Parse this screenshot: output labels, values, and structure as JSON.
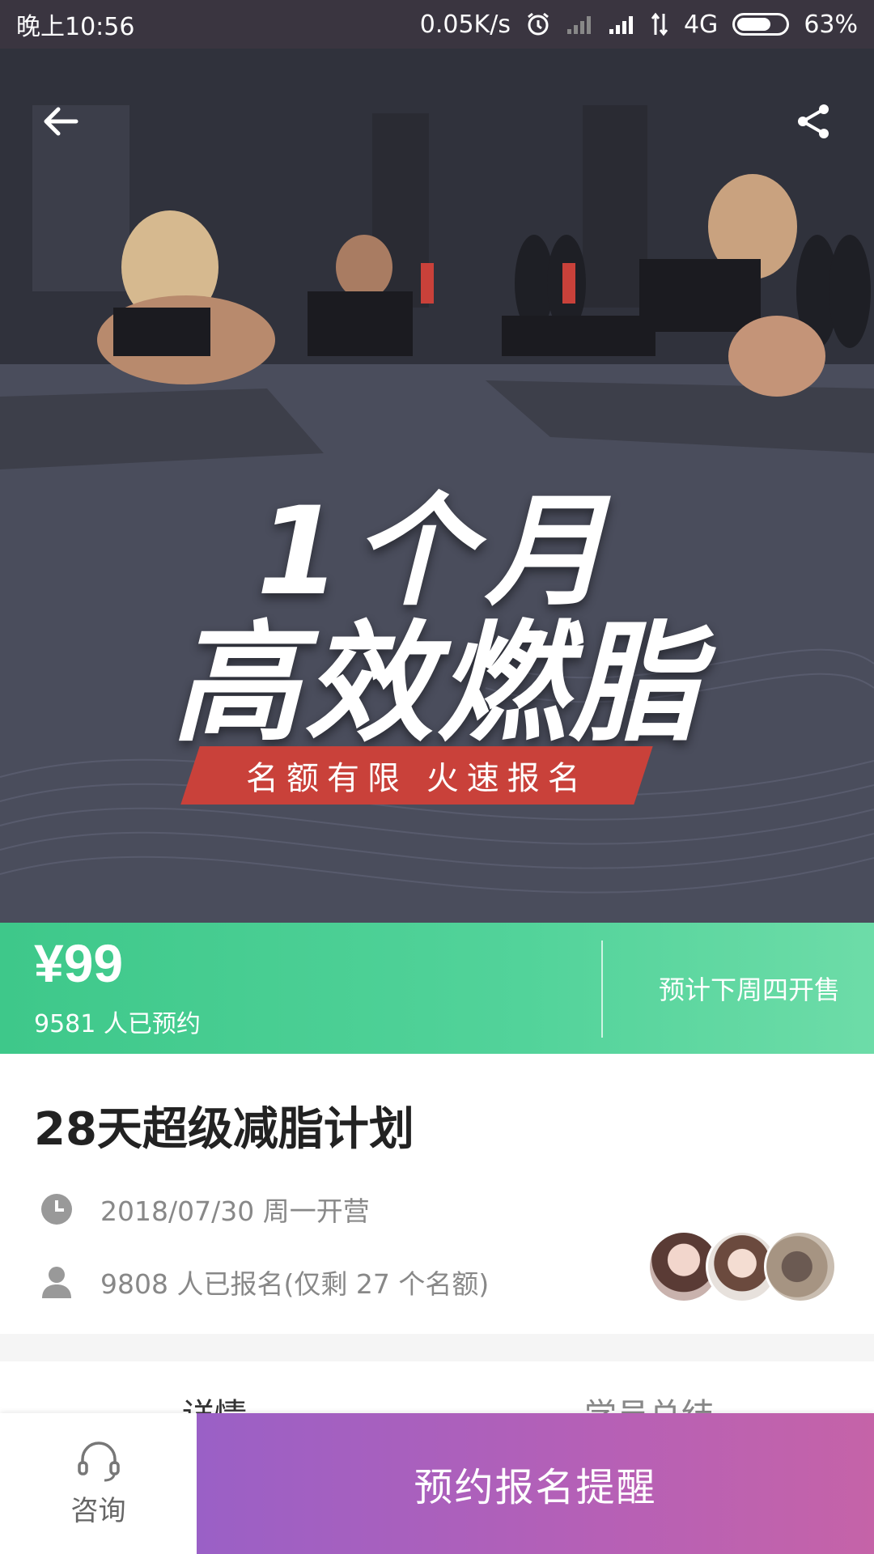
{
  "status_bar": {
    "time": "晚上10:56",
    "net_speed": "0.05K/s",
    "network": "4G",
    "battery": "63%",
    "icons": [
      "alarm-icon",
      "signal-icon",
      "data-arrows-icon",
      "battery-icon"
    ]
  },
  "hero": {
    "line1": "1个月",
    "line2": "高效燃脂",
    "banner": "名额有限  火速报名",
    "back_icon": "arrow-left-icon",
    "share_icon": "share-icon"
  },
  "price_bar": {
    "price": "¥99",
    "reserved": "9581 人已预约",
    "sale_note": "预计下周四开售"
  },
  "course": {
    "title": "28天超级减脂计划",
    "date": "2018/07/30 周一开营",
    "enrolled": "9808 人已报名(仅剩 27 个名额)"
  },
  "tabs": [
    {
      "label": "详情"
    },
    {
      "label": "学员总结"
    }
  ],
  "bottom_bar": {
    "consult_label": "咨询",
    "reserve_label": "预约报名提醒"
  },
  "colors": {
    "status_bar": "#3a3540",
    "price_green": "#3ec88a",
    "banner_red": "#c9413a",
    "button_purple": "#9a60c6",
    "button_pink": "#c563a8"
  }
}
